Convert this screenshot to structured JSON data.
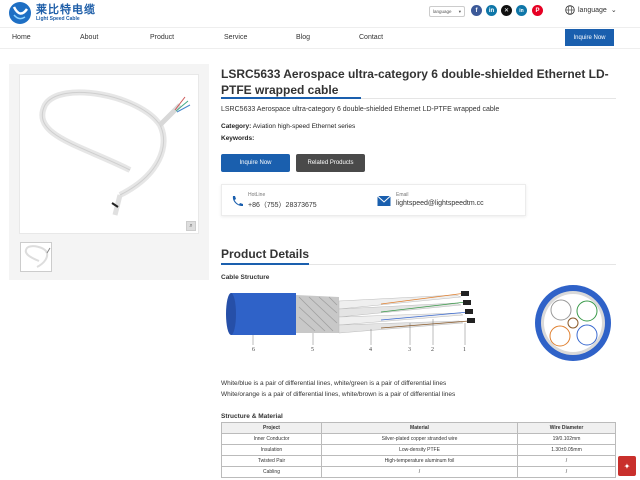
{
  "header": {
    "brand_cn": "莱比特电缆",
    "brand_en": "Light Speed Cable",
    "language_select": "language",
    "language_link": "language",
    "social": [
      "facebook-icon",
      "linkedin-icon",
      "x-icon",
      "pinterest-icon"
    ]
  },
  "nav": {
    "items": [
      "Home",
      "About",
      "Product",
      "Service",
      "Blog",
      "Contact"
    ],
    "inquire": "Inquire Now"
  },
  "product": {
    "title": "LSRC5633 Aerospace ultra-category 6 double-shielded Ethernet LD-PTFE wrapped cable",
    "subtitle": "LSRC5633 Aerospace ultra-category 6 double-shielded Ethernet LD-PTFE wrapped cable",
    "category_label": "Category:",
    "category_value": "Aviation high-speed Ethernet series",
    "keywords_label": "Keywords:",
    "btn_inquire": "Inquire Now",
    "btn_related": "Related Products"
  },
  "contact": {
    "hotline_label": "HotLine",
    "hotline_value": "+86（755）28373675",
    "email_label": "Email",
    "email_value": "lightspeed@lightspeedtm.cc"
  },
  "details": {
    "heading": "Product Details",
    "cable_structure": "Cable Structure",
    "diagram_numbers": [
      "6",
      "5",
      "4",
      "3",
      "2",
      "1"
    ],
    "para1": "White/blue is a pair of differential lines, white/green is a pair of differential lines",
    "para2": "White/orange is a pair of differential lines, white/brown is a pair of differential lines",
    "structure_material": "Structure & Material"
  },
  "table": {
    "headers": [
      "Project",
      "Material",
      "Wire Diameter"
    ],
    "rows": [
      [
        "Inner Conductor",
        "Silver-plated copper stranded wire",
        "19/0.102mm"
      ],
      [
        "Insulation",
        "Low-density PTFE",
        "1.30±0.05mm"
      ],
      [
        "Twisted Pair",
        "High-temperature aluminum foil",
        "/"
      ],
      [
        "Cabling",
        "/",
        "/"
      ]
    ]
  },
  "colors": {
    "accent": "#1a5fae",
    "dark_button": "#4a4a4a",
    "facebook": "#3b5998",
    "linkedin": "#0e76a8",
    "x": "#111111",
    "pinterest": "#e60023",
    "cable_jacket": "#2f62c8"
  }
}
